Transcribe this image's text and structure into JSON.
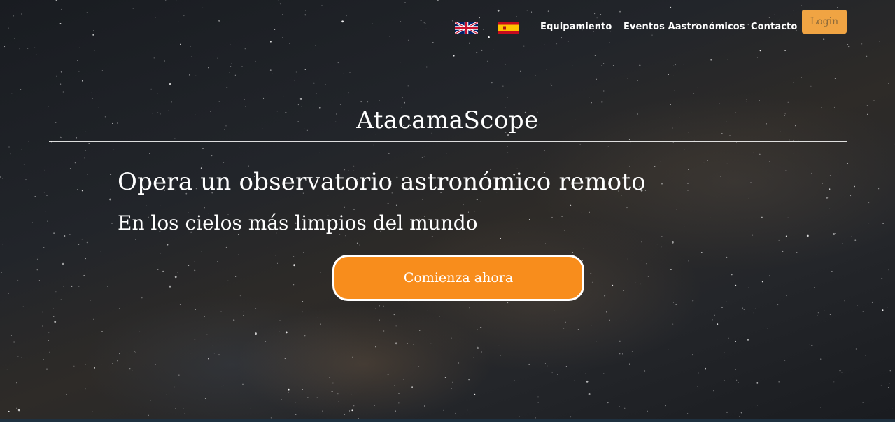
{
  "nav": {
    "flags": [
      {
        "icon": "uk-flag-icon"
      },
      {
        "icon": "spain-flag-icon"
      }
    ],
    "links": [
      "Equipamiento",
      "Eventos Aastronómicos",
      "Contacto"
    ],
    "login_label": "Login"
  },
  "hero": {
    "brand": "AtacamaScope",
    "headline": "Opera un observatorio astronómico remoto",
    "subheadline": "En los cielos más limpios del mundo",
    "cta_label": "Comienza ahora"
  },
  "colors": {
    "login_bg": "#f0a443",
    "cta_bg": "#f88d1c",
    "sky": "#1c1f24",
    "footer_strip": "#1f3140"
  }
}
